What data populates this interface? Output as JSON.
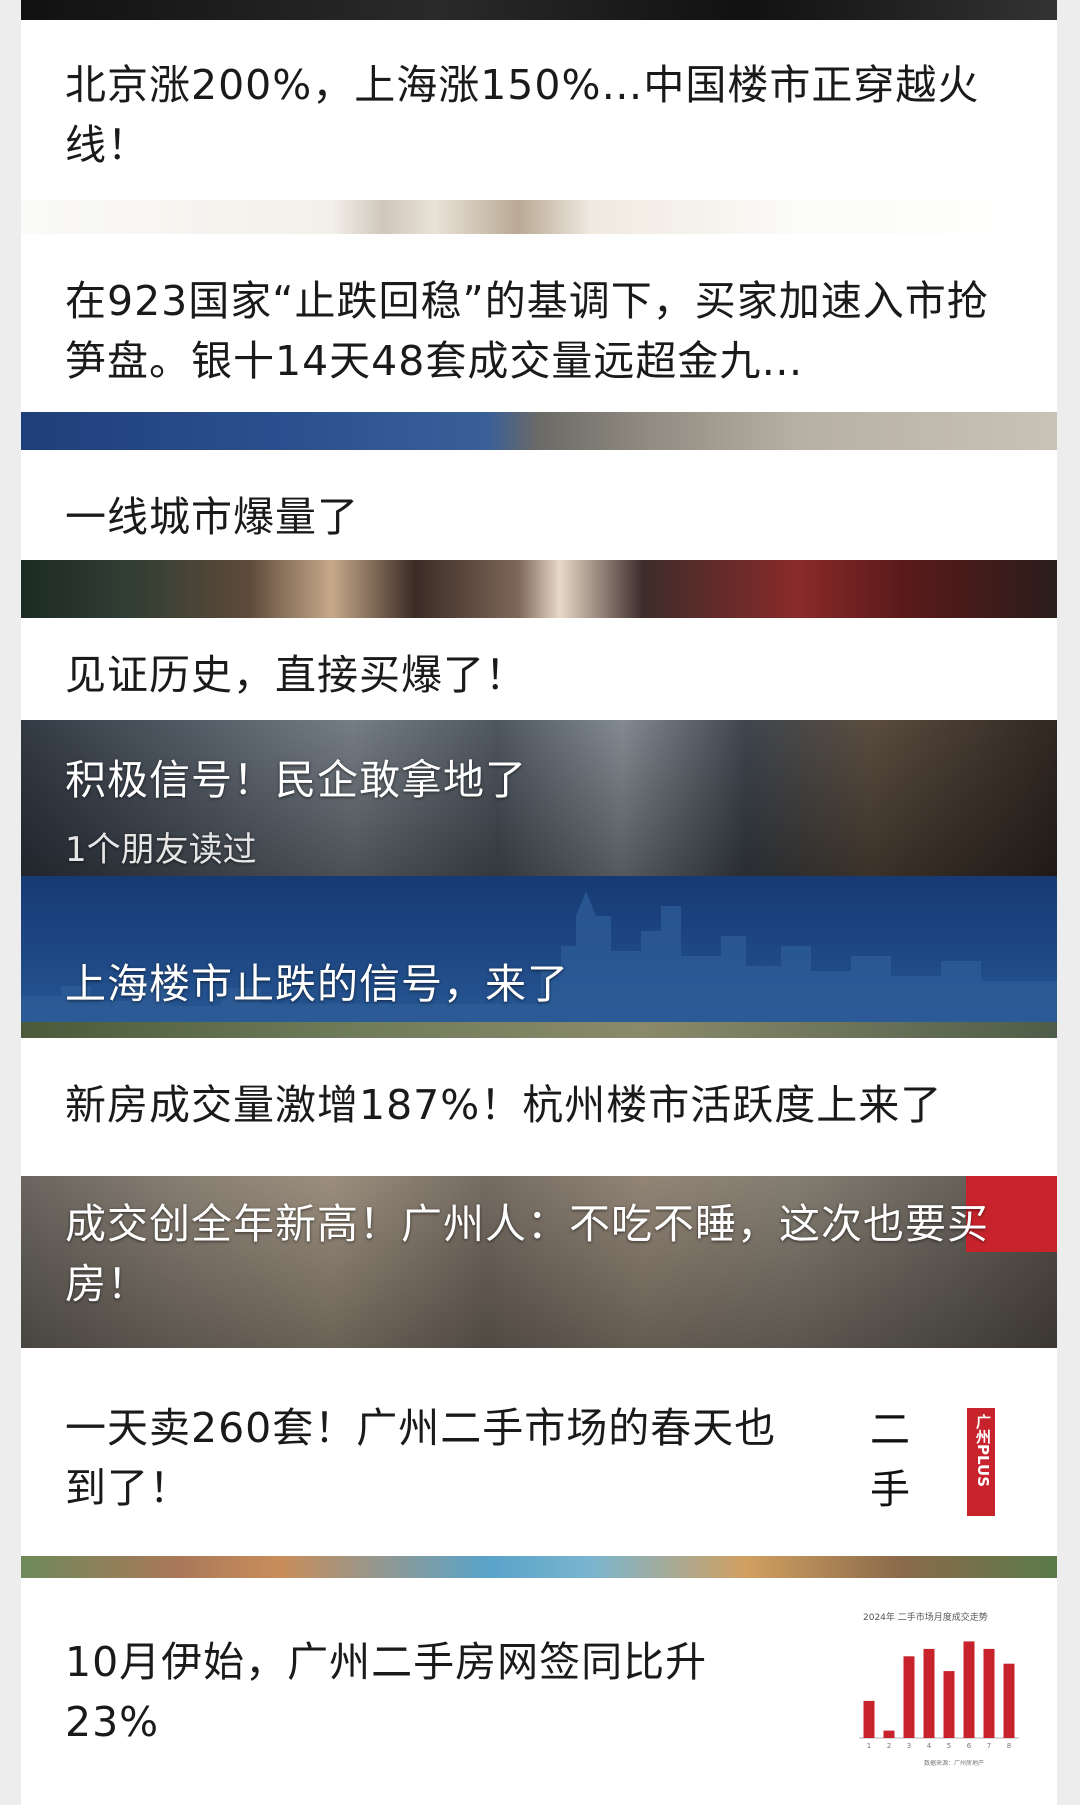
{
  "articles": [
    {
      "title": "北京涨200%，上海涨150%…中国楼市正穿越火线！"
    },
    {
      "title": "在923国家“止跌回稳”的基调下，买家加速入市抢笋盘。银十14天48套成交量远超金九…"
    },
    {
      "title": "一线城市爆量了"
    },
    {
      "title": "见证历史，直接买爆了！"
    },
    {
      "title": "积极信号！民企敢拿地了",
      "meta": "1个朋友读过"
    },
    {
      "title": "上海楼市止跌的信号，来了"
    },
    {
      "title": "新房成交量激增187%！杭州楼市活跃度上来了"
    },
    {
      "title": "成交创全年新高！广州人：不吃不睡，这次也要买房！"
    },
    {
      "title": "一天卖260套！广州二手市场的春天也到了！",
      "thumb": {
        "vertical_text": "二手",
        "badge_text": "广州PLUS"
      }
    },
    {
      "title": "10月伊始，广州二手房网签同比升23%",
      "thumb": {
        "chart_title": "2024年 二手市场月度成交走势",
        "chart_footer": "数据来源：广州房地产"
      }
    }
  ],
  "chart_data": {
    "type": "bar",
    "title": "2024年 二手市场月度成交走势",
    "categories": [
      "1",
      "2",
      "3",
      "4",
      "5",
      "6",
      "7",
      "8"
    ],
    "values": [
      5,
      1,
      11,
      12,
      9,
      13,
      12,
      10
    ],
    "ylim": [
      0,
      14
    ],
    "series_color": "#c8232c"
  },
  "colors": {
    "brand_red": "#c8232c",
    "banner_blue": "#1f4a86"
  }
}
